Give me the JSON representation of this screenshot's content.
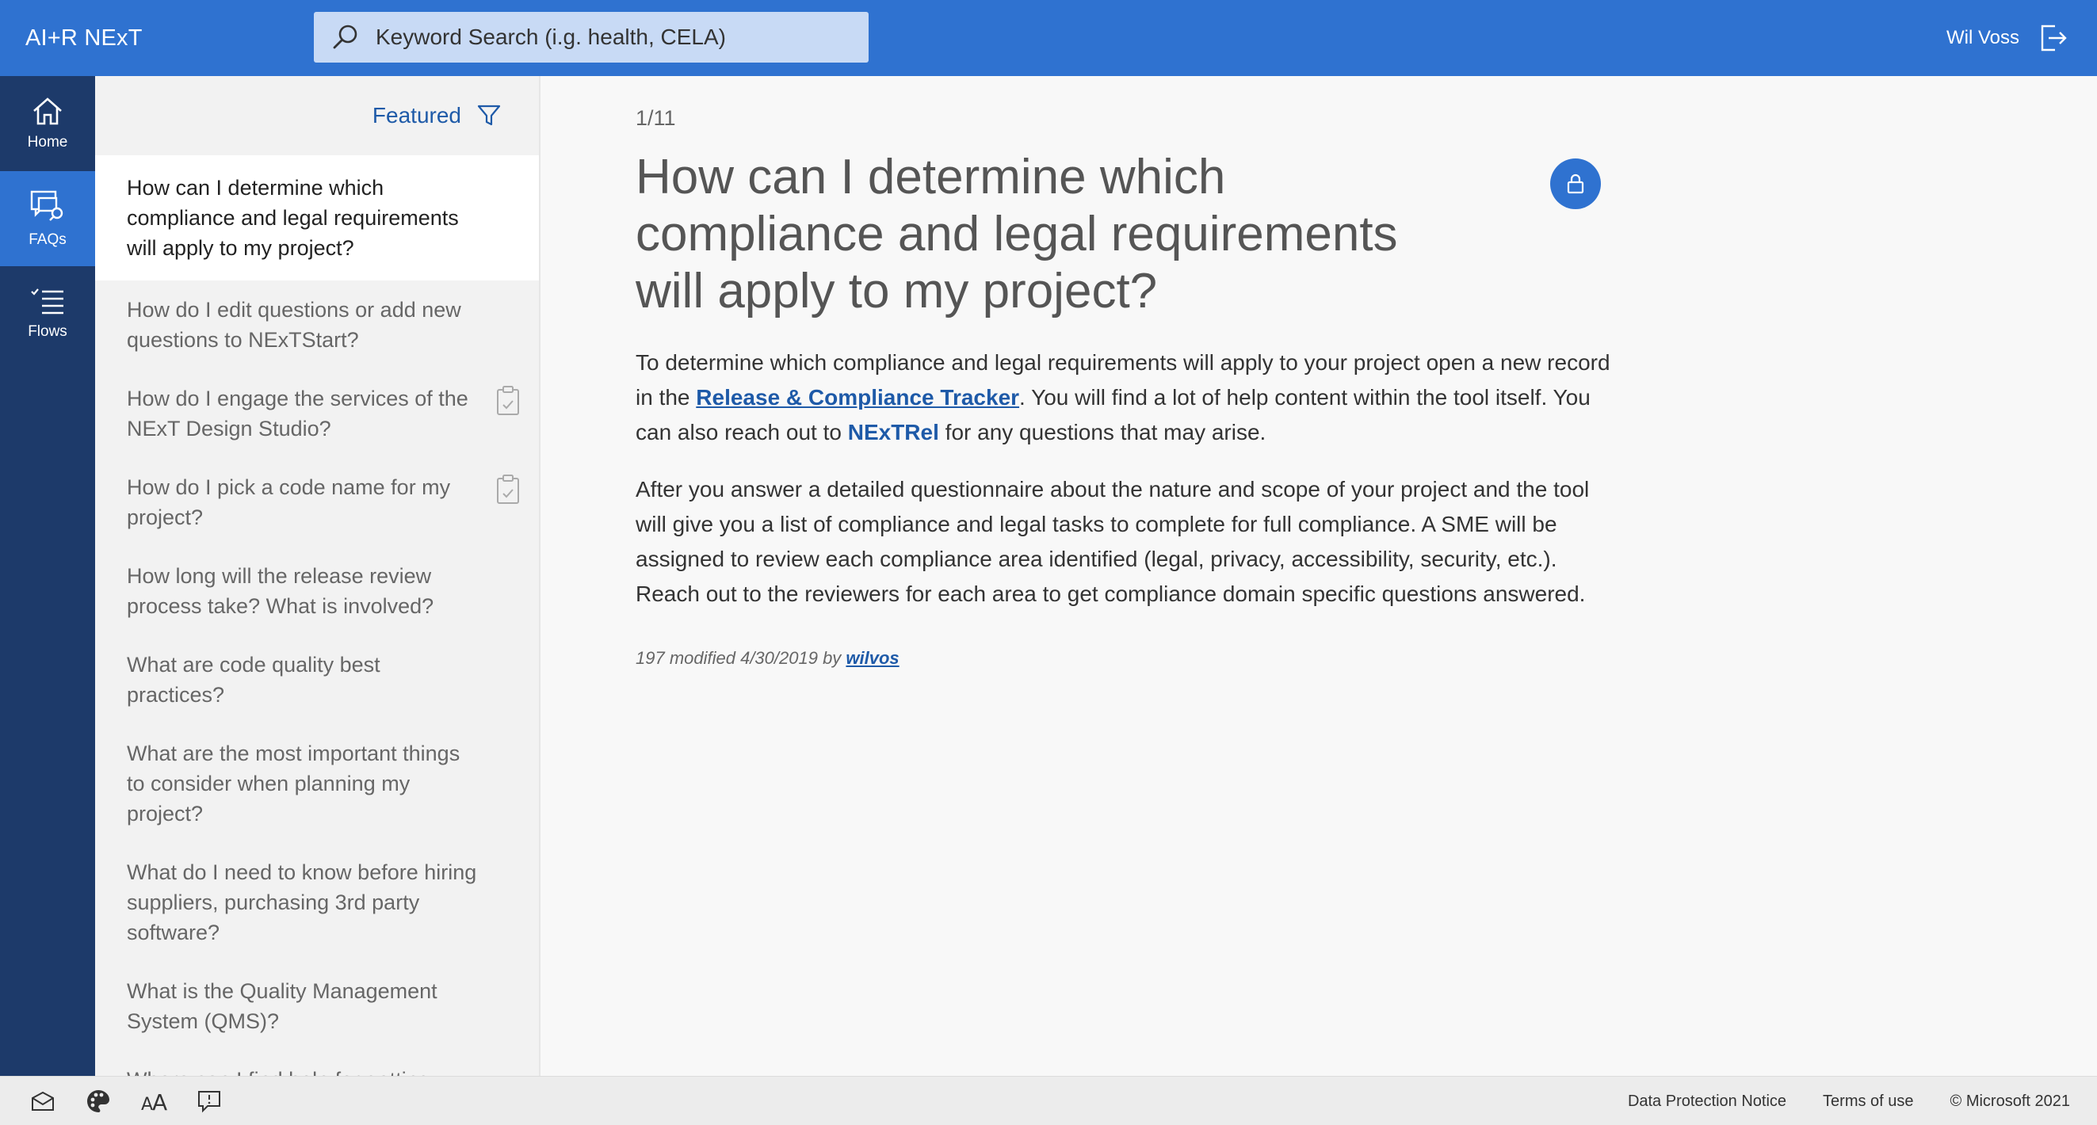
{
  "header": {
    "app_title": "AI+R NExT",
    "search_placeholder": "Keyword Search (i.g. health, CELA)",
    "user_name": "Wil Voss"
  },
  "rail": {
    "home_label": "Home",
    "faqs_label": "FAQs",
    "flows_label": "Flows"
  },
  "list": {
    "filter_label": "Featured",
    "items": [
      {
        "question": "How can I determine which compliance and legal requirements will apply to my project?",
        "active": true,
        "clipboard": false
      },
      {
        "question": "How do I edit questions or add new questions to NExTStart?",
        "active": false,
        "clipboard": false
      },
      {
        "question": "How do I engage the services of the NExT Design Studio?",
        "active": false,
        "clipboard": true
      },
      {
        "question": "How do I pick a code name for my project?",
        "active": false,
        "clipboard": true
      },
      {
        "question": "How long will the release review process take? What is involved?",
        "active": false,
        "clipboard": false
      },
      {
        "question": "What are code quality best practices?",
        "active": false,
        "clipboard": false
      },
      {
        "question": "What are the most important things to consider when planning my project?",
        "active": false,
        "clipboard": false
      },
      {
        "question": "What do I need to know before hiring suppliers, purchasing 3rd party software?",
        "active": false,
        "clipboard": false
      },
      {
        "question": "What is the Quality Management System (QMS)?",
        "active": false,
        "clipboard": false
      },
      {
        "question": "Where can I find help for getting started using or releasing open",
        "active": false,
        "clipboard": false
      }
    ]
  },
  "article": {
    "counter": "1/11",
    "title": "How can I determine which compliance and legal requirements will apply to my project?",
    "p1_a": "To determine which compliance and legal requirements will apply to your project open a new record in the ",
    "p1_link": "Release & Compliance Tracker",
    "p1_b": ". You will find a lot of help content within the tool itself. You can also reach out to ",
    "p1_contact": "NExTRel",
    "p1_c": " for any questions that may arise.",
    "p2": "After you answer a detailed questionnaire about the nature and scope of your project and the tool will give you a list of compliance and legal tasks to complete for full compliance.  A SME will be assigned to review each compliance area identified (legal, privacy, accessibility, security, etc.). Reach out to the reviewers for each area to get compliance domain specific questions answered.",
    "meta_text": "197 modified 4/30/2019 by ",
    "meta_author": "wilvos"
  },
  "footer": {
    "data_protection": "Data Protection Notice",
    "terms": "Terms of use",
    "copyright": "© Microsoft 2021"
  },
  "colors": {
    "brand_blue": "#2f72d0",
    "rail_navy": "#1d3a6a",
    "link_blue": "#1e5aa8"
  },
  "icons": [
    "search-icon",
    "sign-out-icon",
    "home-icon",
    "faq-chat-icon",
    "flows-list-icon",
    "filter-icon",
    "clipboard-icon",
    "lock-icon",
    "mail-icon",
    "palette-icon",
    "text-size-icon",
    "feedback-icon"
  ]
}
